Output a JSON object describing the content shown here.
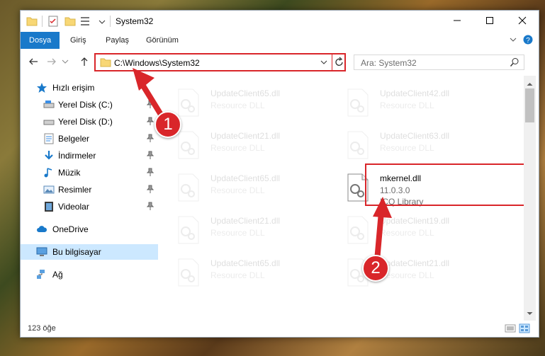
{
  "window": {
    "title": "System32",
    "controls": {
      "minimize": "minimize-icon",
      "maximize": "maximize-icon",
      "close": "close-icon"
    }
  },
  "ribbon": {
    "tabs": [
      {
        "label": "Dosya",
        "active": true
      },
      {
        "label": "Giriş",
        "active": false
      },
      {
        "label": "Paylaş",
        "active": false
      },
      {
        "label": "Görünüm",
        "active": false
      }
    ]
  },
  "address": {
    "path": "C:\\Windows\\System32",
    "search_placeholder": "Ara: System32"
  },
  "nav": {
    "items": [
      {
        "label": "Hızlı erişim",
        "icon": "star-icon",
        "pinned": false
      },
      {
        "label": "Yerel Disk (C:)",
        "icon": "drive-icon",
        "pinned": true
      },
      {
        "label": "Yerel Disk (D:)",
        "icon": "drive-icon",
        "pinned": true
      },
      {
        "label": "Belgeler",
        "icon": "document-icon",
        "pinned": true
      },
      {
        "label": "İndirmeler",
        "icon": "download-icon",
        "pinned": true
      },
      {
        "label": "Müzik",
        "icon": "music-icon",
        "pinned": true
      },
      {
        "label": "Resimler",
        "icon": "picture-icon",
        "pinned": true
      },
      {
        "label": "Videolar",
        "icon": "video-icon",
        "pinned": true
      },
      {
        "label": "OneDrive",
        "icon": "cloud-icon",
        "pinned": false
      },
      {
        "label": "Bu bilgisayar",
        "icon": "computer-icon",
        "pinned": false,
        "selected": true
      },
      {
        "label": "Ağ",
        "icon": "network-icon",
        "pinned": false
      }
    ]
  },
  "files": [
    {
      "name": "UpdateClient65.dll",
      "type": "Resource DLL",
      "faded": true
    },
    {
      "name": "UpdateClient42.dll",
      "type": "Resource DLL",
      "faded": true
    },
    {
      "name": "UpdateClient21.dll",
      "type": "Resource DLL",
      "faded": true
    },
    {
      "name": "UpdateClient63.dll",
      "type": "Resource DLL",
      "faded": true
    },
    {
      "name": "UpdateClient65.dll",
      "type": "Resource DLL",
      "faded": true
    },
    {
      "name": "mkernel.dll",
      "version": "11.0.3.0",
      "type": "ICQ Library",
      "faded": false
    },
    {
      "name": "UpdateClient21.dll",
      "type": "Resource DLL",
      "faded": true
    },
    {
      "name": "UpdateClient19.dll",
      "type": "Resource DLL",
      "faded": true
    },
    {
      "name": "UpdateClient65.dll",
      "type": "Resource DLL",
      "faded": true
    },
    {
      "name": "UpdateClient21.dll",
      "type": "Resource DLL",
      "faded": true
    }
  ],
  "status": {
    "count": "123 öğe"
  },
  "annotations": {
    "step1": "1",
    "step2": "2"
  },
  "colors": {
    "accent": "#1979ca",
    "highlight": "#d9262a",
    "selection": "#cce8ff"
  }
}
